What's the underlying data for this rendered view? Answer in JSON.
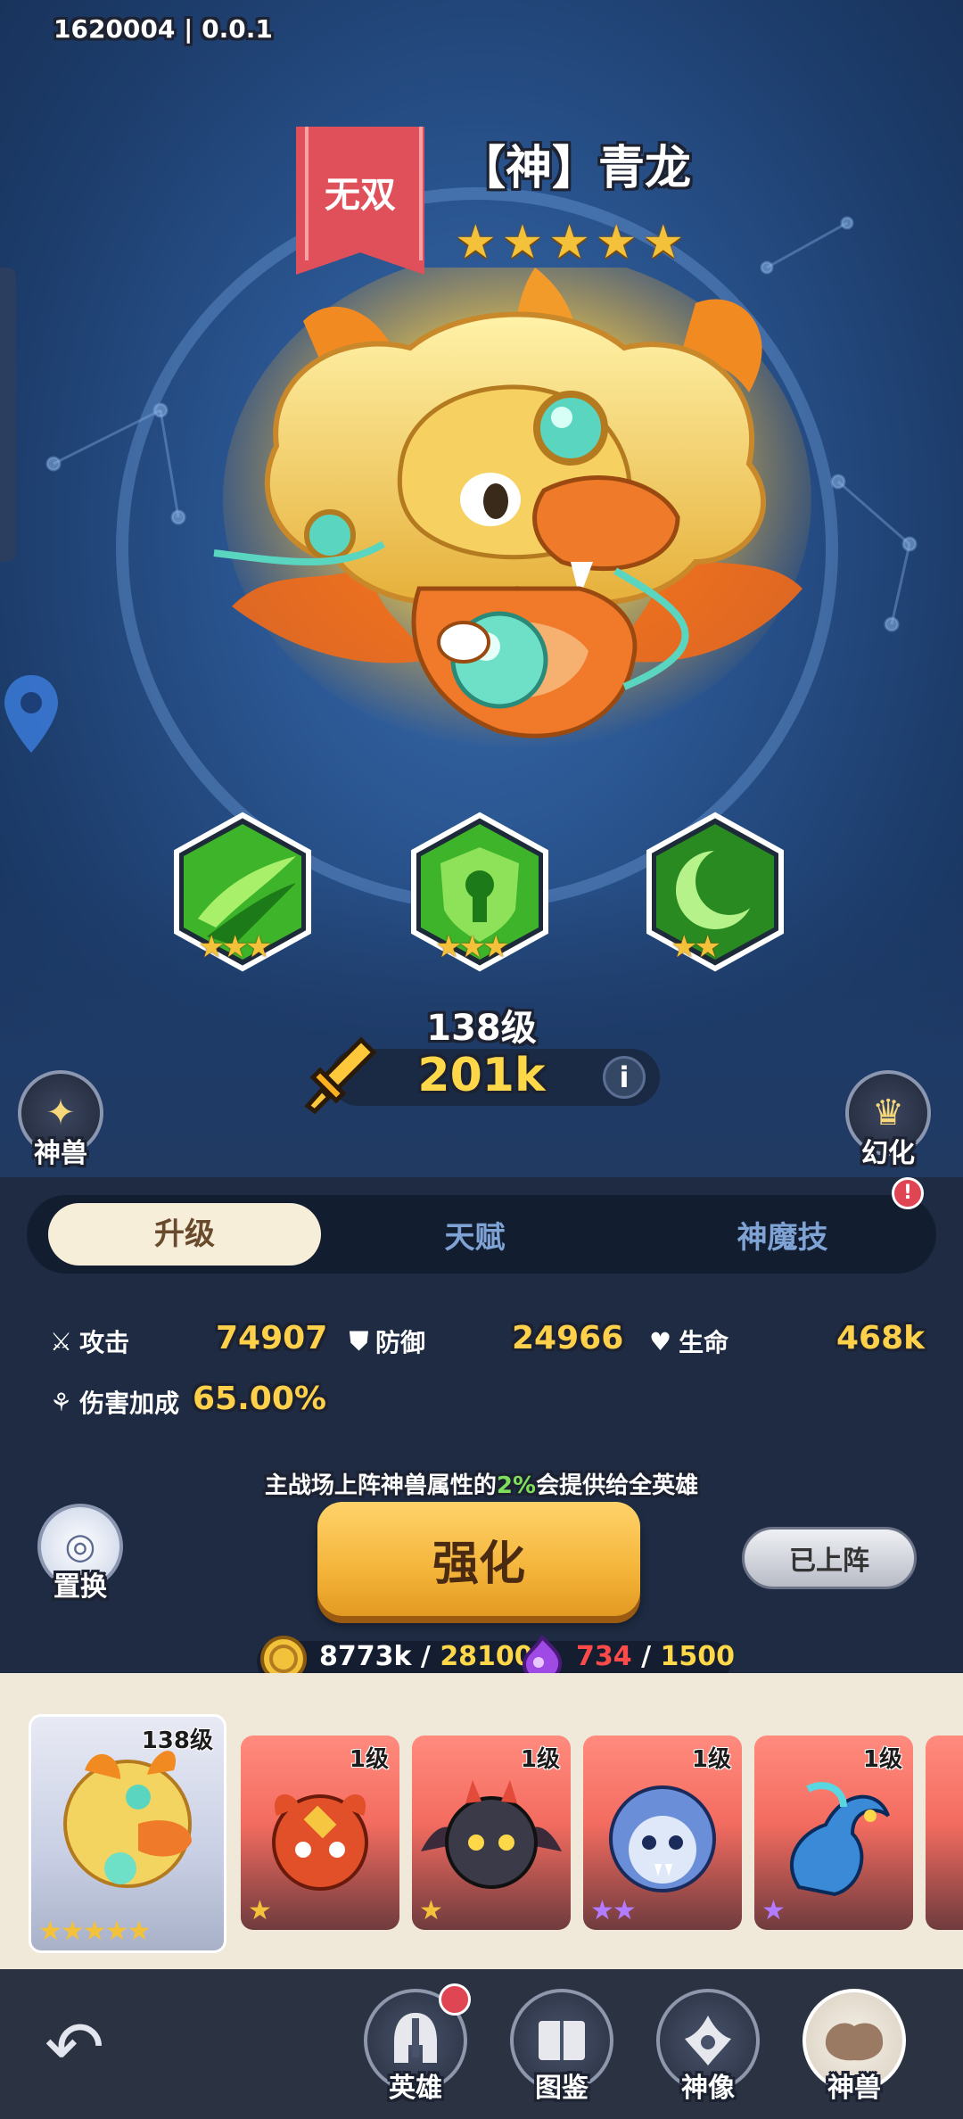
{
  "header": {
    "version": "1620004 | 0.0.1"
  },
  "beast": {
    "tag": "无双",
    "name": "【神】青龙",
    "stars": 5,
    "level_text": "138级",
    "power": "201k",
    "info_icon": "i"
  },
  "skills": [
    {
      "name": "wind-slash-skill-icon",
      "stars": "★★★"
    },
    {
      "name": "keyhole-shield-skill-icon",
      "stars": "★★★"
    },
    {
      "name": "crescent-moon-skill-icon",
      "stars": "★★"
    }
  ],
  "side_buttons": {
    "beast_label": "神兽",
    "transform_label": "幻化",
    "swap_label": "置换"
  },
  "tabs": [
    {
      "label": "升级",
      "active": true
    },
    {
      "label": "天赋",
      "active": false
    },
    {
      "label": "神魔技",
      "active": false,
      "badge": "!"
    }
  ],
  "stats": {
    "attack_label": "攻击",
    "attack_value": "74907",
    "defense_label": "防御",
    "defense_value": "24966",
    "hp_label": "生命",
    "hp_value": "468k",
    "damage_bonus_label": "伤害加成",
    "damage_bonus_value": "65.00%"
  },
  "note": {
    "before": "主战场上阵神兽属性的",
    "highlight": "2%",
    "after": "会提供给全英雄"
  },
  "actions": {
    "upgrade_label": "强化",
    "deployed_label": "已上阵"
  },
  "costs": {
    "gold_have": "8773k",
    "gold_sep": " / ",
    "gold_need": "28100",
    "essence_have": "734",
    "essence_sep": " / ",
    "essence_need": "1500"
  },
  "roster": [
    {
      "level": "138级",
      "stars": "★★★★★",
      "star_color": "#f4c13a",
      "name": "qinglong"
    },
    {
      "level": "1级",
      "stars": "★",
      "star_color": "#f4c13a",
      "name": "red-dragon"
    },
    {
      "level": "1级",
      "stars": "★",
      "star_color": "#f4c13a",
      "name": "black-dragon"
    },
    {
      "level": "1级",
      "stars": "★★",
      "star_color": "#b17cff",
      "name": "blue-lion"
    },
    {
      "level": "1级",
      "stars": "★",
      "star_color": "#b17cff",
      "name": "blue-serpent"
    }
  ],
  "nav": {
    "heroes": "英雄",
    "codex": "图鉴",
    "statue": "神像",
    "beasts": "神兽"
  },
  "colors": {
    "accent_gold": "#ffd84a",
    "badge_red": "#e04553",
    "green_highlight": "#7ee05a"
  }
}
